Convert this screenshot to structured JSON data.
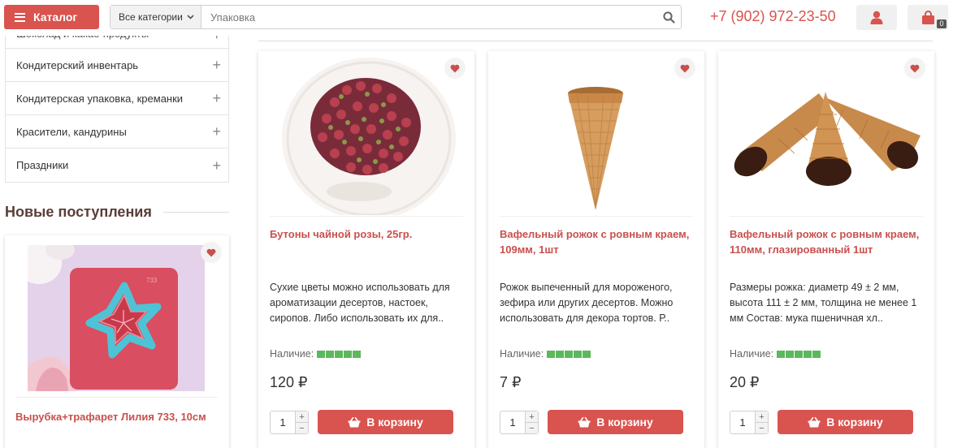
{
  "header": {
    "catalog_label": "Каталог",
    "category_select": "Все категории",
    "search_value": "Упаковка",
    "phone": "+7 (902) 972-23-50",
    "cart_count": "0"
  },
  "sidebar": {
    "items": [
      {
        "label": "Шоколад и какао-продукты"
      },
      {
        "label": "Кондитерский инвентарь"
      },
      {
        "label": "Кондитерская упаковка, креманки"
      },
      {
        "label": "Красители, кандурины"
      },
      {
        "label": "Праздники"
      }
    ]
  },
  "new_arrivals": {
    "title": "Новые поступления",
    "item": {
      "title": "Вырубка+трафарет Лилия 733, 10см",
      "image_text": "733"
    }
  },
  "products": [
    {
      "title": "Бутоны чайной розы, 25гр.",
      "desc": "Сухие цветы можно использовать для ароматизации десертов, настоек, сиропов. Либо использовать их для..",
      "stock_label": "Наличие:",
      "price": "120 ₽",
      "qty": "1",
      "cart_label": "В корзину"
    },
    {
      "title": "Вафельный рожок с ровным краем, 109мм, 1шт",
      "desc": "Рожок выпеченный для мороженого, зефира или других десертов. Можно использовать для декора тортов. Р..",
      "stock_label": "Наличие:",
      "price": "7 ₽",
      "qty": "1",
      "cart_label": "В корзину"
    },
    {
      "title": "Вафельный рожок с ровным краем, 110мм, глазированный 1шт",
      "desc": "Размеры рожка: диаметр 49 ± 2 мм, высота 111 ± 2 мм, толщина не менее 1 мм Состав: мука пшеничная хл..",
      "stock_label": "Наличие:",
      "price": "20 ₽",
      "qty": "1",
      "cart_label": "В корзину"
    }
  ],
  "colors": {
    "accent": "#d9534f",
    "title": "#c9504c",
    "stock": "#5cb85c"
  },
  "icons": [
    "hamburger-icon",
    "chevron-down-icon",
    "search-icon",
    "user-icon",
    "shopping-bag-icon",
    "heart-icon",
    "plus-icon",
    "basket-icon"
  ]
}
